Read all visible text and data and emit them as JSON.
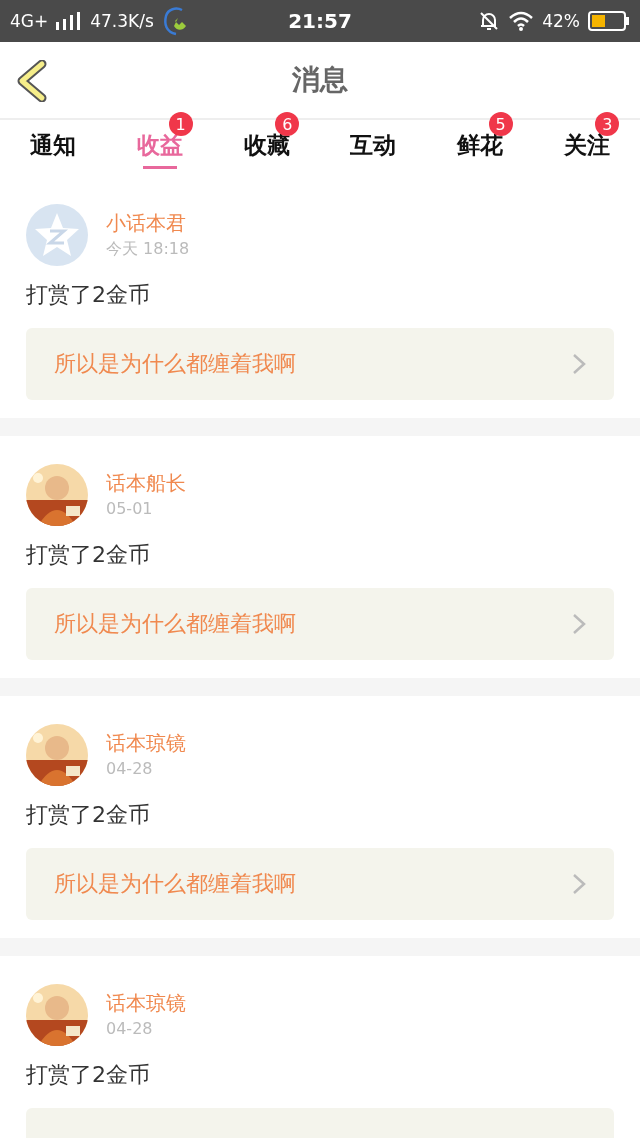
{
  "status_bar": {
    "network": "4G+",
    "speed": "47.3K/s",
    "time": "21:57",
    "battery": "42%"
  },
  "header": {
    "title": "消息"
  },
  "tabs": [
    {
      "label": "通知",
      "selected": false
    },
    {
      "label": "收益",
      "selected": true,
      "badge": "1"
    },
    {
      "label": "收藏",
      "selected": false,
      "badge": "6"
    },
    {
      "label": "互动",
      "selected": false
    },
    {
      "label": "鲜花",
      "selected": false,
      "badge": "5"
    },
    {
      "label": "关注",
      "selected": false,
      "badge": "3"
    }
  ],
  "messages": [
    {
      "avatar": {
        "kind": "logo"
      },
      "name": "小话本君",
      "time": "今天 18:18",
      "text": "打赏了2金币",
      "quote": "所以是为什么都缠着我啊"
    },
    {
      "name": "话本船长",
      "time": "05-01",
      "text": "打赏了2金币",
      "quote": "所以是为什么都缠着我啊"
    },
    {
      "name": "话本琼镜",
      "time": "04-28",
      "text": "打赏了2金币",
      "quote": "所以是为什么都缠着我啊"
    },
    {
      "name": "话本琼镜",
      "time": "04-28",
      "text": "打赏了2金币"
    }
  ]
}
